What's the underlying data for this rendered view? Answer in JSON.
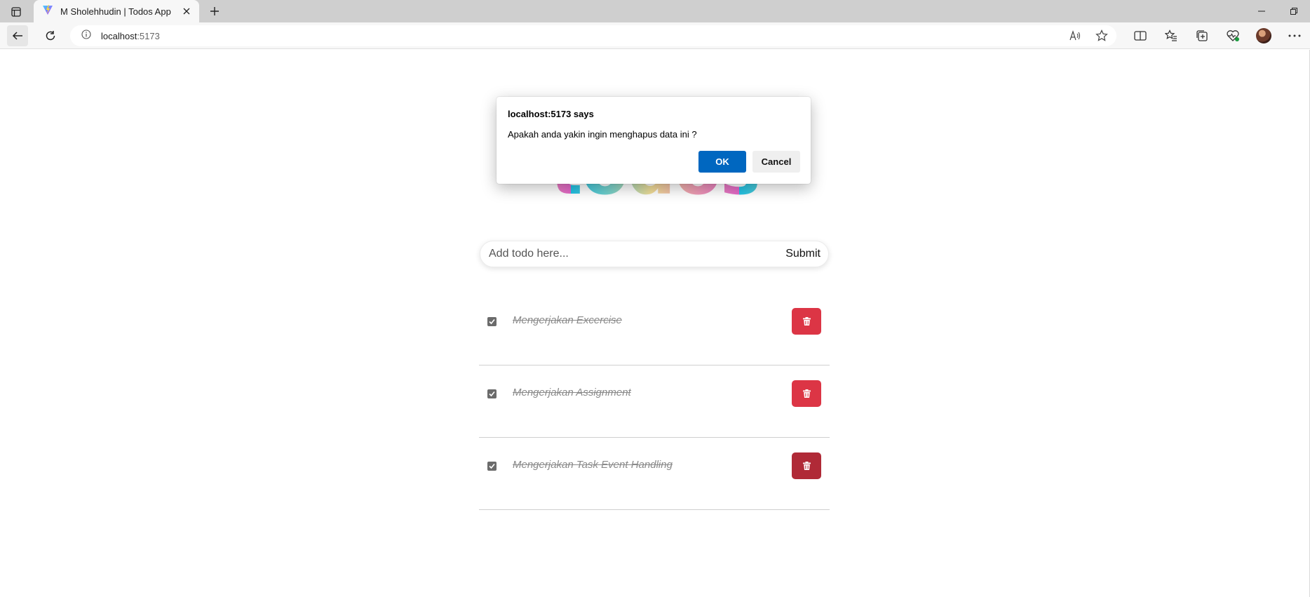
{
  "browser": {
    "tab_title": "M Sholehhudin | Todos App",
    "url_host": "localhost",
    "url_port": ":5173"
  },
  "app": {
    "logo_letters": [
      "t",
      "o",
      "d",
      "o",
      "s"
    ],
    "add_placeholder": "Add todo here...",
    "submit_label": "Submit",
    "todos": [
      {
        "title": "Mengerjakan Excercise",
        "completed": true
      },
      {
        "title": "Mengerjakan Assignment",
        "completed": true
      },
      {
        "title": "Mengerjakan Task Event Handling",
        "completed": true
      }
    ]
  },
  "dialog": {
    "title": "localhost:5173 says",
    "message": "Apakah anda yakin ingin menghapus data ini ?",
    "ok_label": "OK",
    "cancel_label": "Cancel"
  },
  "colors": {
    "delete_button": "#dc3545",
    "delete_button_hover": "#b02a37",
    "dialog_ok": "#0067c0",
    "logo_gradient": [
      "#20c3e6",
      "#7fd3c9",
      "#f2de97",
      "#f0a4b1",
      "#e468c9"
    ]
  },
  "icons": {
    "tab_actions": "tab-actions-icon",
    "favicon": "vite-logo-icon",
    "close_tab": "close-icon",
    "new_tab": "plus-icon",
    "back": "arrow-left-icon",
    "reload": "reload-icon",
    "site_info": "info-icon",
    "read_aloud": "read-aloud-icon",
    "favorite": "star-icon",
    "split_screen": "split-screen-icon",
    "favorites": "favorites-icon",
    "collections": "collections-icon",
    "browser_essentials": "heart-pulse-icon",
    "profile": "avatar",
    "more": "ellipsis-icon",
    "delete": "trash-icon",
    "checkbox": "checkmark-icon"
  }
}
